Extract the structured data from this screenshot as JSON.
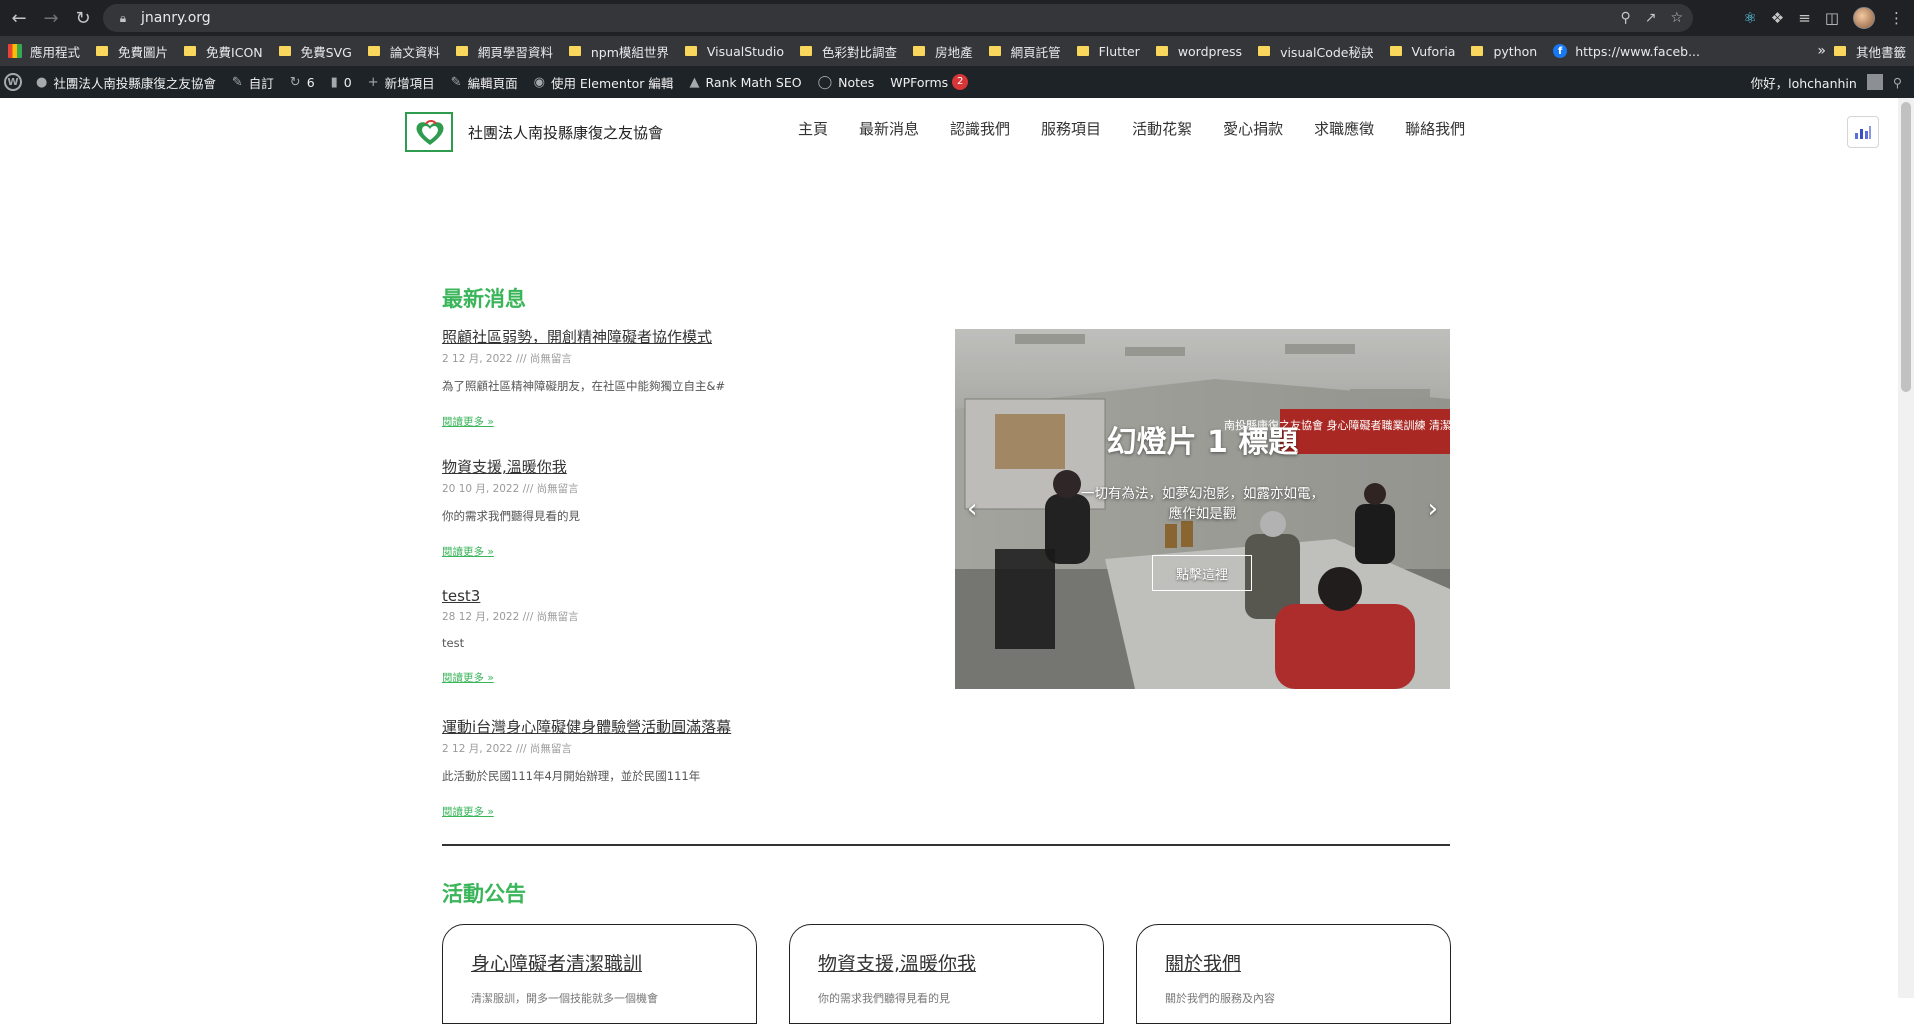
{
  "browser": {
    "url": "jnanry.org",
    "bookmarks": [
      "應用程式",
      "免費圖片",
      "免費ICON",
      "免費SVG",
      "論文資料",
      "網頁學習資料",
      "npm模組世界",
      "VisualStudio",
      "色彩對比調查",
      "房地產",
      "網頁託管",
      "Flutter",
      "wordpress",
      "visualCode秘訣",
      "Vuforia",
      "python",
      "https://www.faceb..."
    ],
    "more_bookmarks": "»",
    "other_bookmarks": "其他書籤"
  },
  "wp_admin_bar": {
    "site_name": "社團法人南投縣康復之友協會",
    "customize": "自訂",
    "updates_count": "6",
    "comments_count": "0",
    "new_item": "新增項目",
    "edit_page": "編輯頁面",
    "elementor": "使用 Elementor 編輯",
    "rank_math": "Rank Math SEO",
    "notes": "Notes",
    "wpforms": "WPForms",
    "wpforms_badge": "2",
    "greeting": "你好，lohchanhin"
  },
  "header": {
    "site_title": "社團法人南投縣康復之友協會",
    "nav": [
      "主頁",
      "最新消息",
      "認識我們",
      "服務項目",
      "活動花絮",
      "愛心捐款",
      "求職應徵",
      "聯絡我們"
    ]
  },
  "news": {
    "section_title": "最新消息",
    "items": [
      {
        "title": "照顧社區弱勢，開創精神障礙者協作模式",
        "meta": "2 12 月, 2022 /// 尚無留言",
        "excerpt": "為了照顧社區精神障礙朋友，在社區中能夠獨立自主&#",
        "more": "閱讀更多 »"
      },
      {
        "title": "物資支援,溫暖你我",
        "meta": "20 10 月, 2022 /// 尚無留言",
        "excerpt": "你的需求我們聽得見看的見",
        "more": "閱讀更多 »"
      },
      {
        "title": "test3",
        "meta": "28 12 月, 2022 /// 尚無留言",
        "excerpt": "test",
        "more": "閱讀更多 »"
      },
      {
        "title": "運動i台灣身心障礙健身體驗營活動圓滿落幕",
        "meta": "2 12 月, 2022 /// 尚無留言",
        "excerpt": "此活動於民國111年4月開始辦理，並於民國111年",
        "more": "閱讀更多 »"
      }
    ]
  },
  "slider": {
    "title": "幻燈片 1 標題",
    "description": "一切有為法，如夢幻泡影，如露亦如電，應作如是觀",
    "button": "點擊這裡",
    "banner_text": "南投縣康復之友協會 身心障礙者職業訓練 清潔人員培訓班"
  },
  "events": {
    "section_title": "活動公告",
    "cards": [
      {
        "title": "身心障礙者清潔職訓",
        "text": "清潔服訓，開多一個技能就多一個機會"
      },
      {
        "title": "物資支援,溫暖你我",
        "text": "你的需求我們聽得見看的見"
      },
      {
        "title": "關於我們",
        "text": "關於我們的服務及內容"
      }
    ]
  }
}
